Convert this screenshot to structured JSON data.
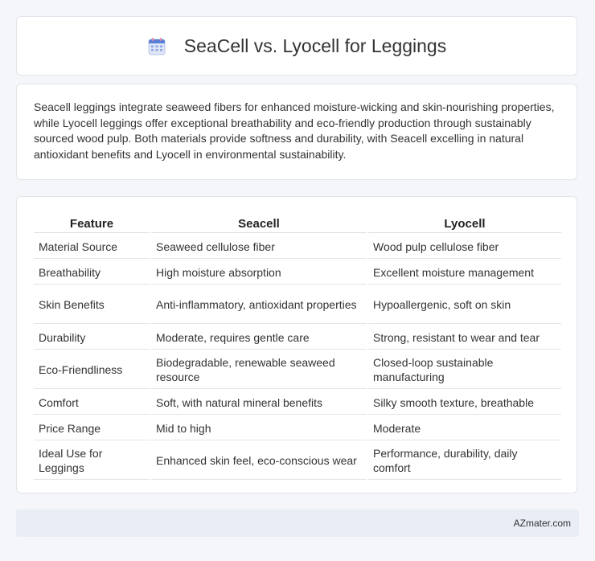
{
  "header": {
    "title": "SeaCell vs. Lyocell for Leggings",
    "icon": "calendar-icon"
  },
  "summary": {
    "text": "Seacell leggings integrate seaweed fibers for enhanced moisture-wicking and skin-nourishing properties, while Lyocell leggings offer exceptional breathability and eco-friendly production through sustainably sourced wood pulp. Both materials provide softness and durability, with Seacell excelling in natural antioxidant benefits and Lyocell in environmental sustainability."
  },
  "table": {
    "headers": [
      "Feature",
      "Seacell",
      "Lyocell"
    ],
    "rows": [
      [
        "Material Source",
        "Seaweed cellulose fiber",
        "Wood pulp cellulose fiber"
      ],
      [
        "Breathability",
        "High moisture absorption",
        "Excellent moisture management"
      ],
      [
        "Skin Benefits",
        "Anti-inflammatory, antioxidant properties",
        "Hypoallergenic, soft on skin"
      ],
      [
        "Durability",
        "Moderate, requires gentle care",
        "Strong, resistant to wear and tear"
      ],
      [
        "Eco-Friendliness",
        "Biodegradable, renewable seaweed resource",
        "Closed-loop sustainable manufacturing"
      ],
      [
        "Comfort",
        "Soft, with natural mineral benefits",
        "Silky smooth texture, breathable"
      ],
      [
        "Price Range",
        "Mid to high",
        "Moderate"
      ],
      [
        "Ideal Use for Leggings",
        "Enhanced skin feel, eco-conscious wear",
        "Performance, durability, daily comfort"
      ]
    ]
  },
  "footer": {
    "brand": "AZmater.com"
  },
  "colors": {
    "page_background": "#f5f6fa",
    "card_background": "#ffffff",
    "footer_background": "#e8edf6",
    "icon_blue": "#5b7fd6",
    "icon_pink": "#e58aa8"
  }
}
